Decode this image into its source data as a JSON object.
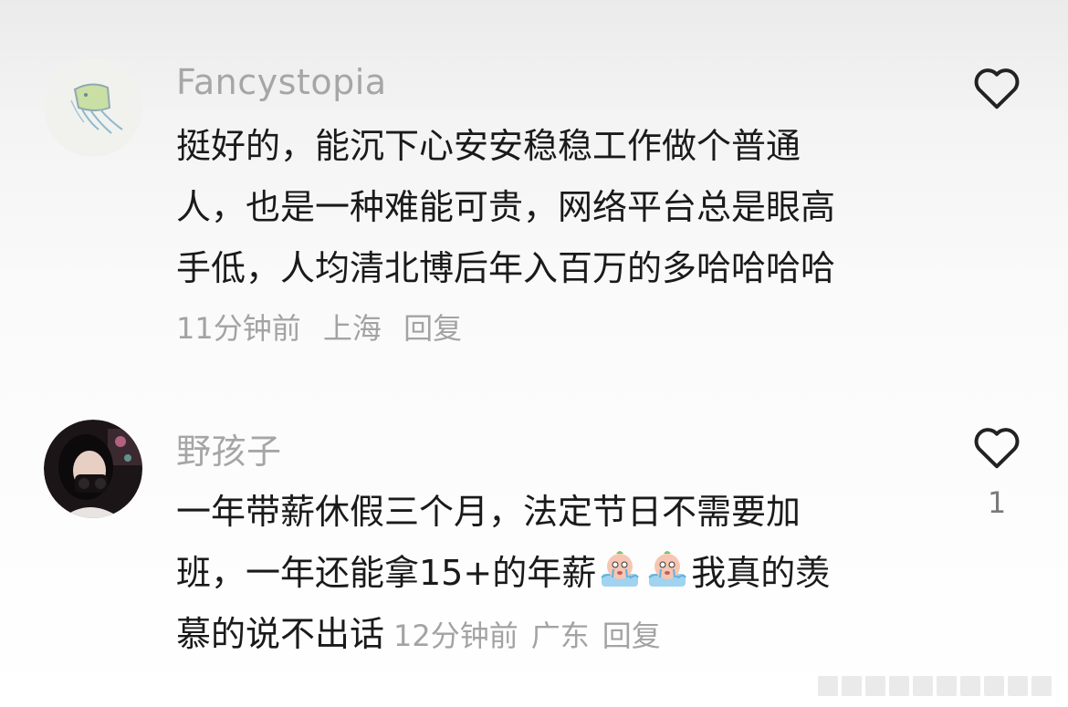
{
  "comments": [
    {
      "username": "Fancystopia",
      "avatar_icon": "jellyfish-sketch-avatar",
      "lines": [
        "挺好的，能沉下心安安稳稳工作做个普通",
        "人，也是一种难能可贵，网络平台总是眼高",
        "手低，人均清北博后年入百万的多哈哈哈哈"
      ],
      "time": "11分钟前",
      "location": "上海",
      "reply_label": "回复",
      "like_count": "",
      "like_icon": "heart-outline-icon"
    },
    {
      "username": "野孩子",
      "avatar_icon": "girl-photo-avatar",
      "lines": [
        "一年带薪休假三个月，法定节日不需要加",
        "班，一年还能拿15+的年薪",
        "我真的羡",
        "慕的说不出话"
      ],
      "time": "12分钟前",
      "location": "广东",
      "reply_label": "回复",
      "like_count": "1",
      "like_icon": "heart-outline-icon",
      "emoji_icon": "crying-peach-emoji"
    }
  ],
  "colors": {
    "username": "#a6a6a6",
    "text": "#1a1a1a",
    "meta": "#a3a3a3"
  }
}
